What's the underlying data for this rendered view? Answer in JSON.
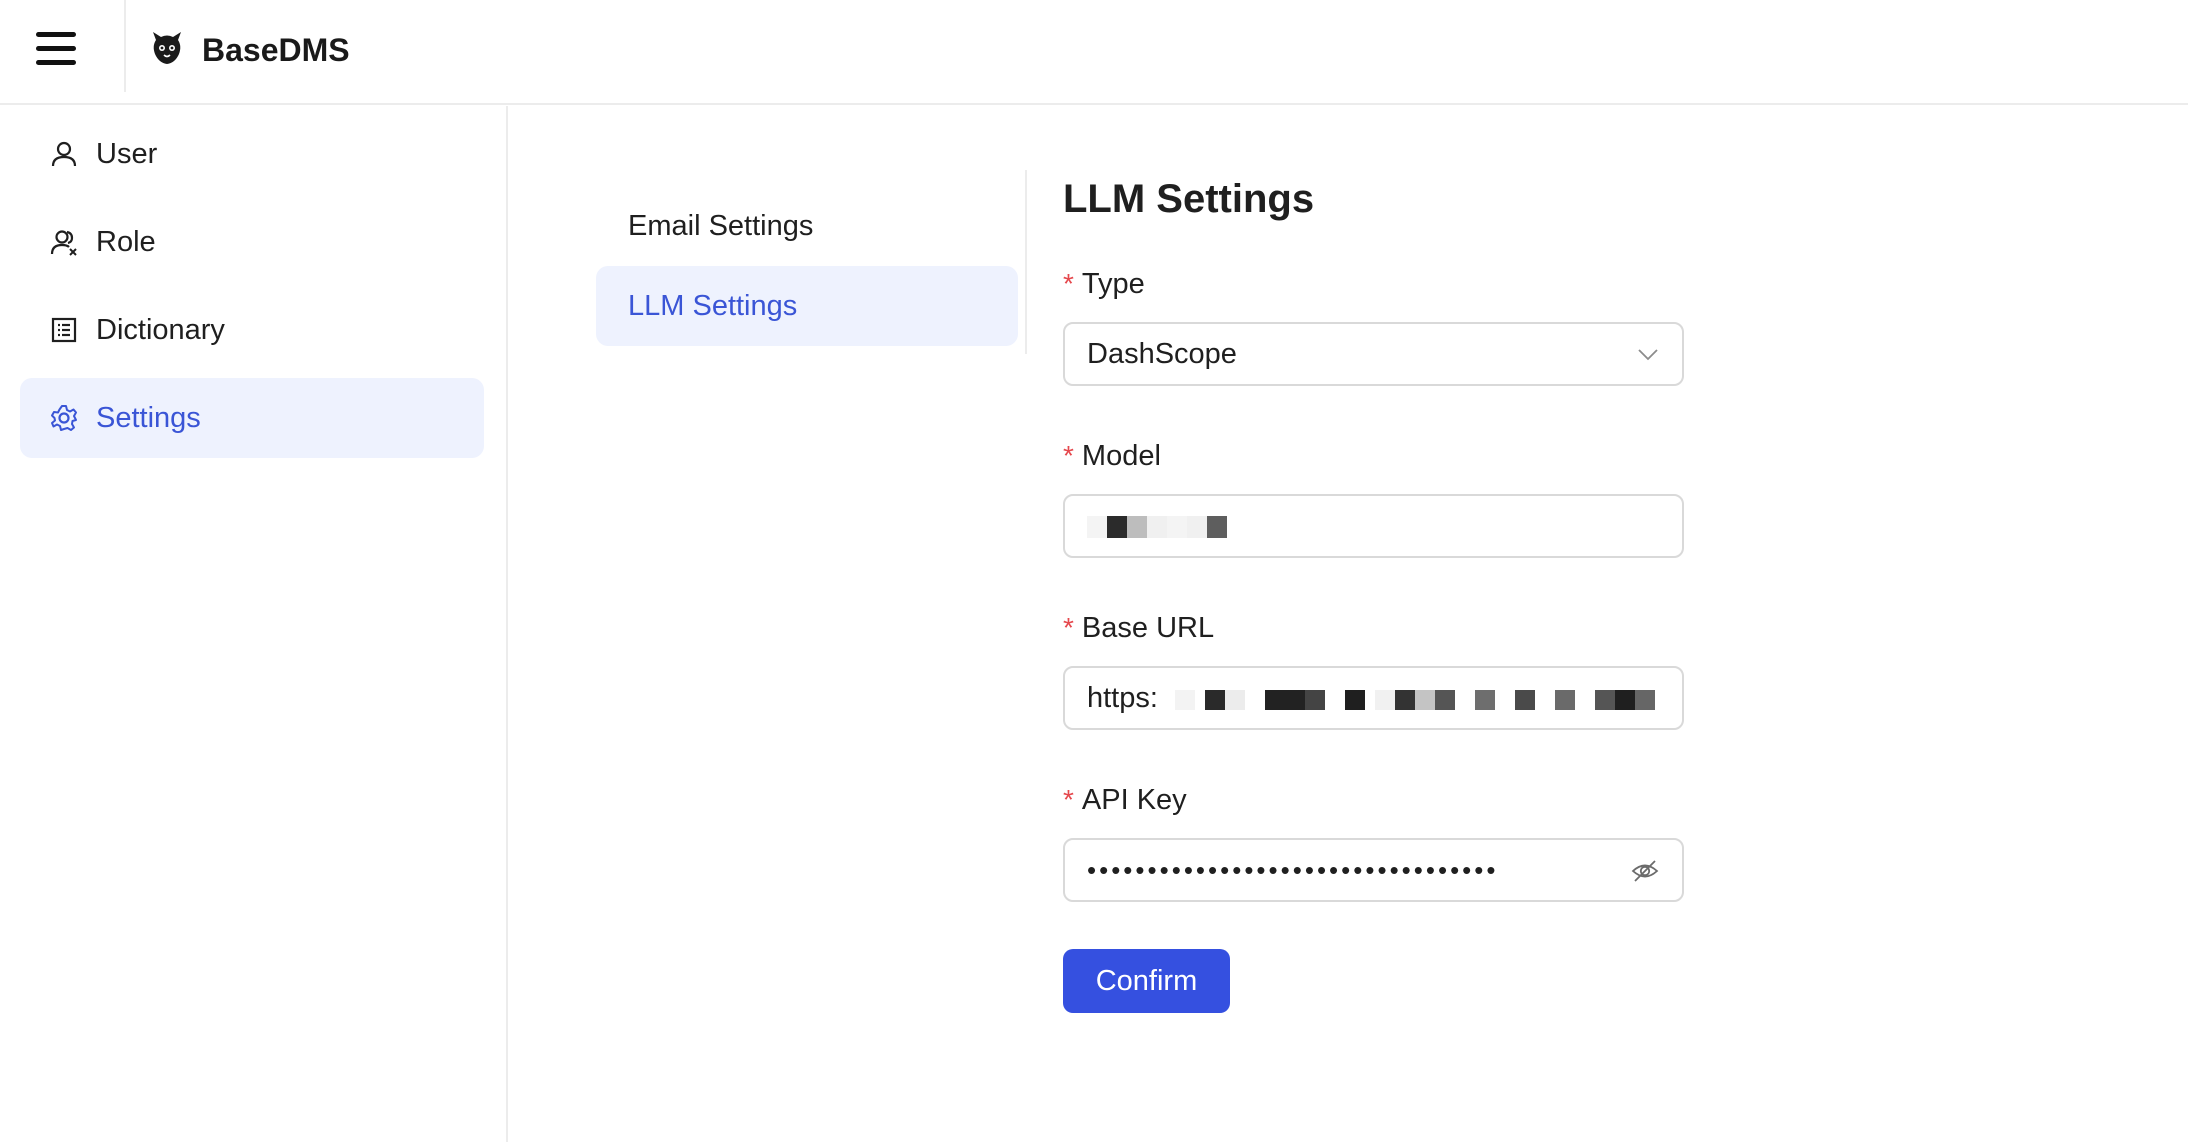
{
  "app": {
    "title": "BaseDMS"
  },
  "sidebar": {
    "items": [
      {
        "label": "User",
        "icon": "user-icon"
      },
      {
        "label": "Role",
        "icon": "users-icon"
      },
      {
        "label": "Dictionary",
        "icon": "list-icon"
      },
      {
        "label": "Settings",
        "icon": "gear-icon",
        "active": true
      }
    ]
  },
  "settings_menu": {
    "items": [
      {
        "label": "Email Settings"
      },
      {
        "label": "LLM Settings",
        "active": true
      }
    ]
  },
  "form": {
    "title": "LLM Settings",
    "required_marker": "*",
    "type": {
      "label": "Type",
      "value": "DashScope"
    },
    "model": {
      "label": "Model",
      "value": ""
    },
    "base_url": {
      "label": "Base URL",
      "value": "https:"
    },
    "api_key": {
      "label": "API Key",
      "value": "••••••••••••••••••••••••••••••••••"
    },
    "confirm_label": "Confirm"
  },
  "colors": {
    "accent": "#3550e0",
    "active_bg": "#eef2fe",
    "active_text": "#3a55d6",
    "required": "#e5484d"
  }
}
